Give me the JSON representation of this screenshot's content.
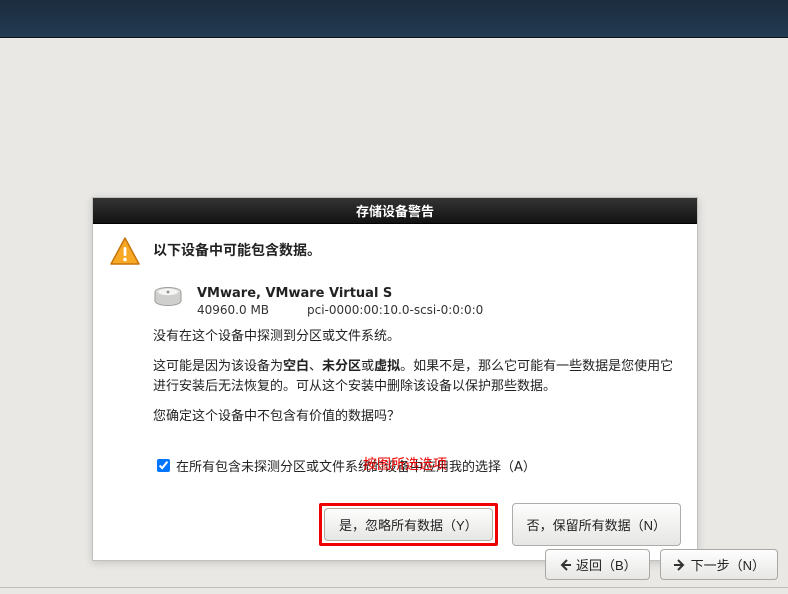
{
  "dialog": {
    "title": "存储设备警告",
    "heading": "以下设备中可能包含数据。",
    "device": {
      "name": "VMware, VMware Virtual S",
      "size": "40960.0 MB",
      "path": "pci-0000:00:10.0-scsi-0:0:0:0"
    },
    "para1": "没有在这个设备中探测到分区或文件系统。",
    "para2_a": "这可能是因为该设备为",
    "para2_bold1": "空白",
    "para2_sep1": "、",
    "para2_bold2": "未分区",
    "para2_sep2": "或",
    "para2_bold3": "虚拟",
    "para2_b": "。如果不是，那么它可能有一些数据是您使用它进行安装后无法恢复的。可从这个安装中删除该设备以保护那些数据。",
    "para3": "您确定这个设备中不包含有价值的数据吗？",
    "checkbox_label": "在所有包含未探测分区或文件系统的设备中应用我的选择（A）",
    "red_annotation": "按图所选选项",
    "btn_yes": "是，忽略所有数据（Y）",
    "btn_no": "否，保留所有数据（N）"
  },
  "nav": {
    "back": "返回（B）",
    "next": "下一步（N）"
  }
}
